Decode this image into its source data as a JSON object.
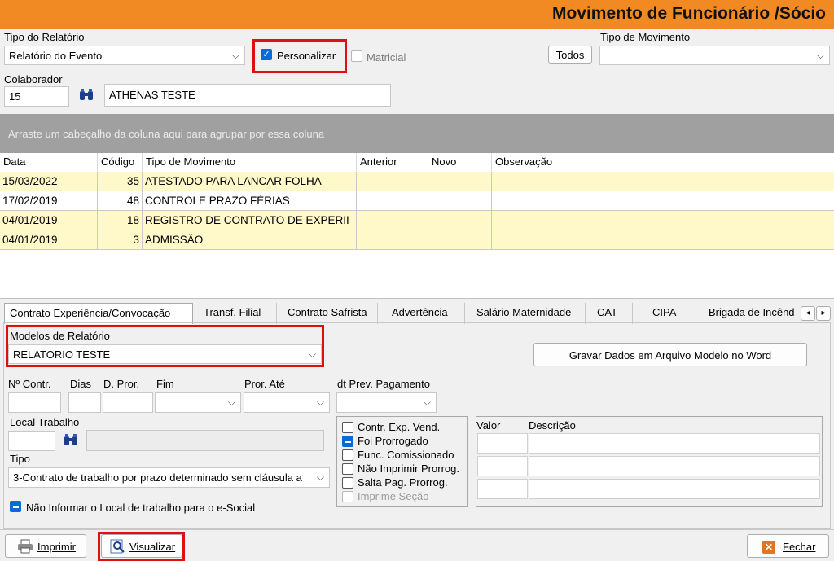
{
  "window": {
    "title": "Movimento de Funcionário /Sócio"
  },
  "report_type": {
    "label": "Tipo do Relatório",
    "value": "Relatório do Evento"
  },
  "personalizar": {
    "label": "Personalizar",
    "checked": true
  },
  "matricial": {
    "label": "Matricial",
    "checked": false
  },
  "todos_button": "Todos",
  "movement_type": {
    "label": "Tipo de Movimento",
    "value": ""
  },
  "collaborator": {
    "label": "Colaborador",
    "code": "15",
    "name": "ATHENAS TESTE"
  },
  "group_panel_text": "Arraste um cabeçalho da coluna aqui para agrupar por essa coluna",
  "grid": {
    "columns": [
      "Data",
      "Código",
      "Tipo de Movimento",
      "Anterior",
      "Novo",
      "Observação"
    ],
    "rows": [
      {
        "data": "15/03/2022",
        "codigo": "35",
        "tipo": "ATESTADO PARA LANCAR FOLHA",
        "anterior": "",
        "novo": "",
        "obs": ""
      },
      {
        "data": "17/02/2019",
        "codigo": "48",
        "tipo": "CONTROLE PRAZO FÉRIAS",
        "anterior": "",
        "novo": "",
        "obs": ""
      },
      {
        "data": "04/01/2019",
        "codigo": "18",
        "tipo": "REGISTRO DE CONTRATO DE EXPERII",
        "anterior": "",
        "novo": "",
        "obs": ""
      },
      {
        "data": "04/01/2019",
        "codigo": "3",
        "tipo": "ADMISSÃO",
        "anterior": "",
        "novo": "",
        "obs": ""
      }
    ]
  },
  "tabs": [
    "Contrato Experiência/Convocação",
    "Transf. Filial",
    "Contrato Safrista",
    "Advertência",
    "Salário Maternidade",
    "CAT",
    "CIPA",
    "Brigada de Incênd"
  ],
  "tab_scroll": {
    "left": "◂",
    "right": "▸"
  },
  "modelos": {
    "label": "Modelos de Relatório",
    "value": "RELATORIO TESTE"
  },
  "gravar_button": "Gravar Dados em Arquivo Modelo no Word",
  "fields": {
    "n_contr": "Nº Contr.",
    "dias": "Dias",
    "d_pror": "D. Pror.",
    "fim": "Fim",
    "pror_ate": "Pror. Até",
    "dt_prev": "dt Prev. Pagamento",
    "local_trabalho": "Local Trabalho",
    "tipo": "Tipo",
    "tipo_value": "3-Contrato de trabalho por prazo determinado sem cláusula a"
  },
  "nao_informar": {
    "label": "Não Informar o Local de trabalho para o e-Social",
    "state": "indeterminate"
  },
  "options": [
    {
      "label": "Contr. Exp. Vend.",
      "state": "unchecked"
    },
    {
      "label": "Foi Prorrogado",
      "state": "indeterminate"
    },
    {
      "label": "Func. Comissionado",
      "state": "unchecked"
    },
    {
      "label": "Não Imprimir Prorrog.",
      "state": "unchecked"
    },
    {
      "label": "Salta Pag. Prorrog.",
      "state": "unchecked"
    },
    {
      "label": "Imprime Seção",
      "state": "disabled"
    }
  ],
  "valor_grid": {
    "columns": [
      "Valor",
      "Descrição"
    ]
  },
  "bottom": {
    "imprimir": "Imprimir",
    "visualizar": "Visualizar",
    "fechar": "Fechar"
  },
  "colors": {
    "title_bar": "#f28a23",
    "highlight": "#e01010",
    "row_yellow": "#fff8c8",
    "check_blue": "#0b6bd6"
  }
}
